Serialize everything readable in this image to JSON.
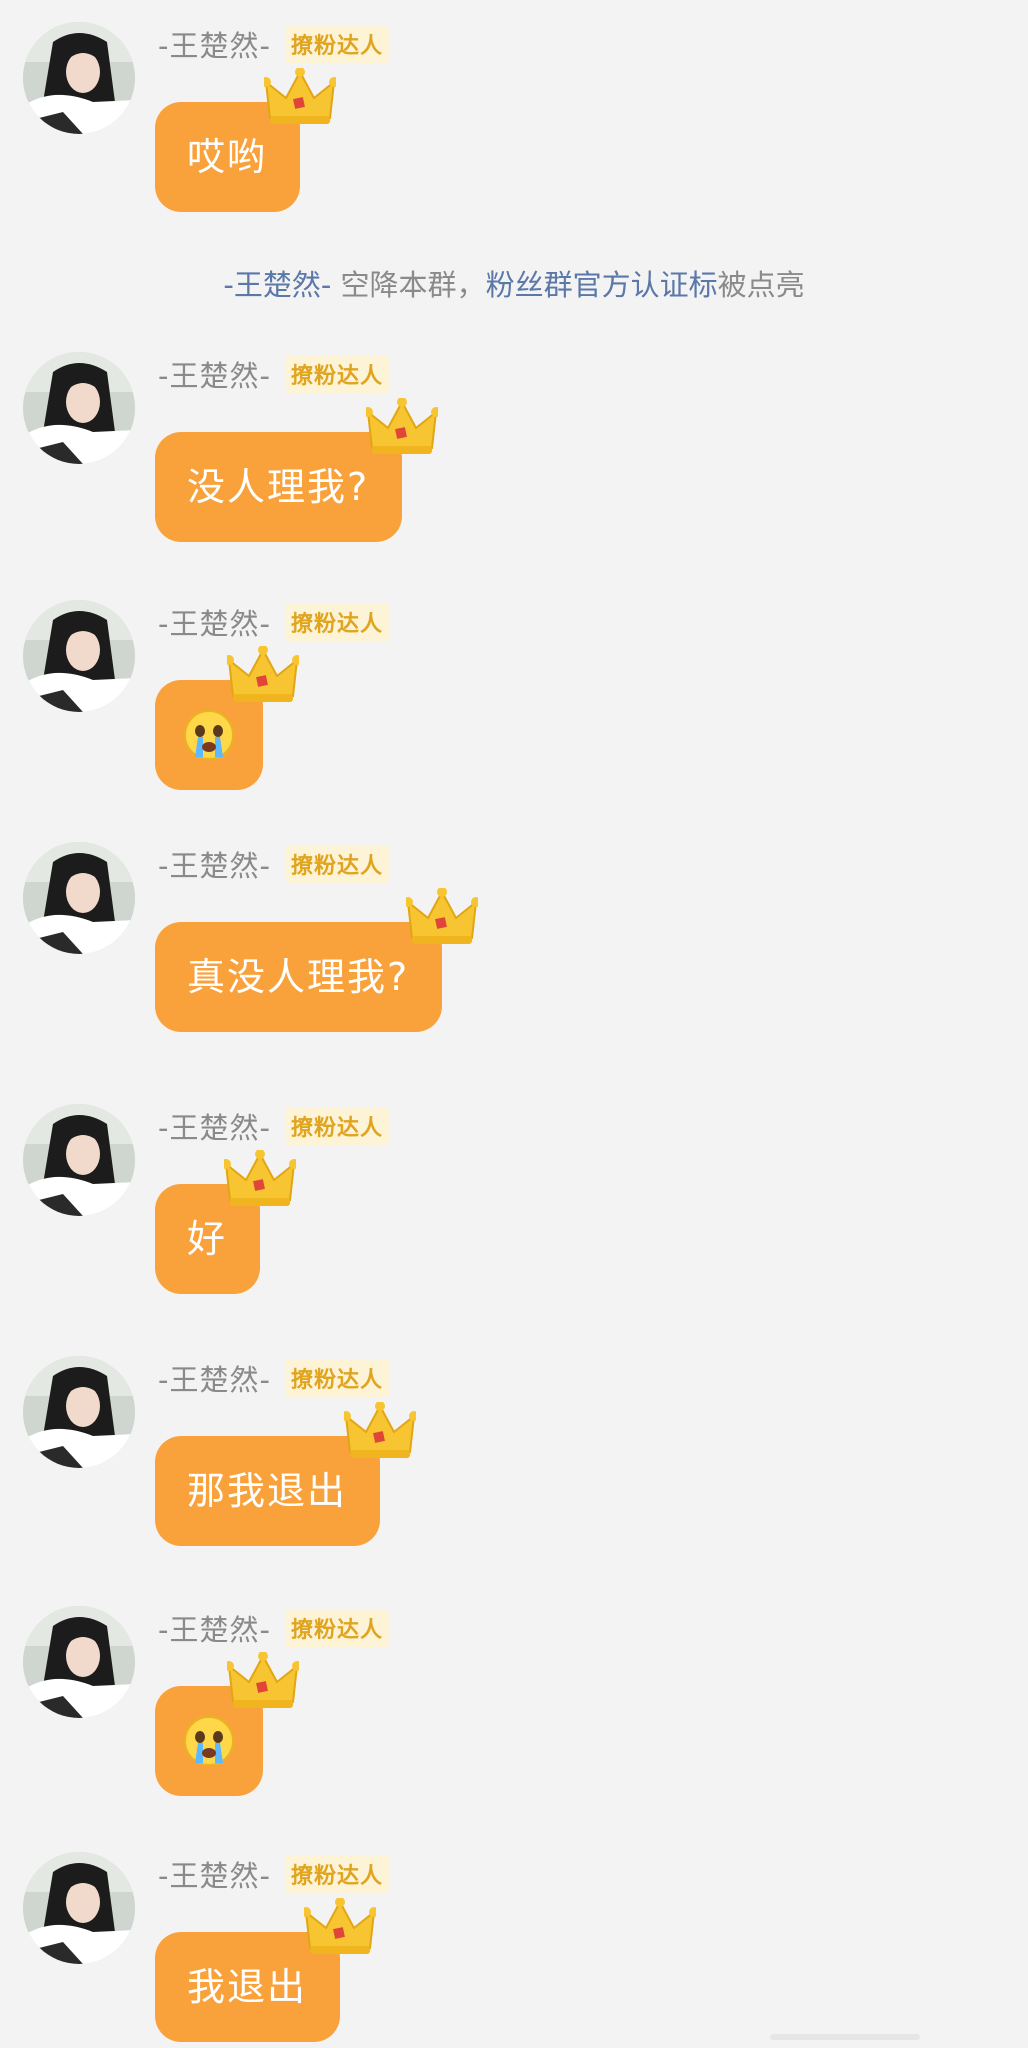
{
  "messages": [
    {
      "name": "-王楚然-",
      "badge": "撩粉达人",
      "text": "哎哟",
      "kind": "text"
    },
    {
      "name": "-王楚然-",
      "badge": "撩粉达人",
      "text": "没人理我?",
      "kind": "text"
    },
    {
      "name": "-王楚然-",
      "badge": "撩粉达人",
      "text": "",
      "kind": "emoji",
      "emoji": "loudly-crying-face-icon"
    },
    {
      "name": "-王楚然-",
      "badge": "撩粉达人",
      "text": "真没人理我?",
      "kind": "text"
    },
    {
      "name": "-王楚然-",
      "badge": "撩粉达人",
      "text": "好",
      "kind": "text"
    },
    {
      "name": "-王楚然-",
      "badge": "撩粉达人",
      "text": "那我退出",
      "kind": "text"
    },
    {
      "name": "-王楚然-",
      "badge": "撩粉达人",
      "text": "",
      "kind": "emoji",
      "emoji": "loudly-crying-face-icon"
    },
    {
      "name": "-王楚然-",
      "badge": "撩粉达人",
      "text": "我退出",
      "kind": "text"
    }
  ],
  "system_notice": {
    "name_link": "-王楚然-",
    "middle_text": " 空降本群，",
    "cert_link": "粉丝群官方认证标",
    "tail_text": "被点亮"
  },
  "colors": {
    "bubble": "#f9a23c",
    "background": "#f3f3f3",
    "badge_text": "#e0a41f",
    "link": "#5b78a8"
  },
  "icons": {
    "avatar": "avatar-photo",
    "crown": "crown-icon",
    "emoji": "loudly-crying-face-icon"
  }
}
